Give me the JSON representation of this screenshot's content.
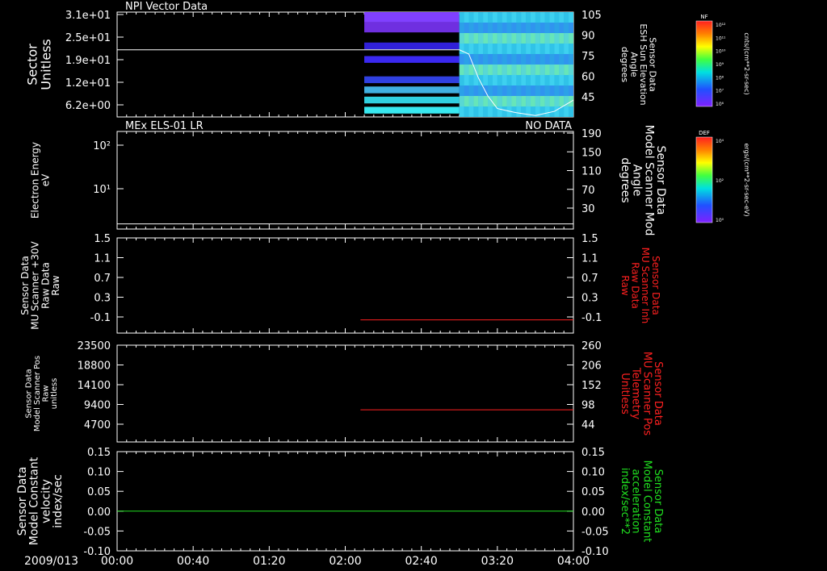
{
  "date_label": "2009/013",
  "time_ticks": [
    "00:00",
    "00:40",
    "01:20",
    "02:00",
    "02:40",
    "03:20",
    "04:00"
  ],
  "colorbars": [
    {
      "tag": "NF",
      "unit": "cnts/(cm**2-sr-sec)",
      "ticks": [
        "10¹²",
        "10¹¹",
        "10¹⁰",
        "10⁹",
        "10⁸",
        "10⁷",
        "10⁶"
      ]
    },
    {
      "tag": "DEF",
      "unit": "ergs/(cm**2-sr-sec-eV)",
      "ticks": [
        "10⁴",
        "10²",
        "10⁰"
      ]
    }
  ],
  "panels": [
    {
      "title_left": "NPI Vector Data",
      "title_right": "",
      "ylabel": [
        "Sector",
        "Unitless"
      ],
      "ylabel_size": 16,
      "ylabel_color": "#ffffff",
      "yticks": [
        "3.1e+01",
        "2.5e+01",
        "1.9e+01",
        "1.2e+01",
        "6.2e+00"
      ],
      "y2label": [
        "Sensor Data",
        "ESH Sun Elevation",
        "Angle",
        "degrees"
      ],
      "y2label_color": "#ffffff",
      "y2label_size": 11,
      "y2ticks": [
        "105",
        "90",
        "75",
        "60",
        "45"
      ]
    },
    {
      "title_left": "MEx ELS-01 LR",
      "title_right": "NO DATA",
      "ylabel": [
        "Electron Energy",
        "eV"
      ],
      "ylabel_size": 12,
      "ylabel_color": "#ffffff",
      "yticks": [
        "10²",
        "10¹"
      ],
      "y2label": [
        "Sensor Data",
        "Model Scanner Mod",
        "Angle",
        "degrees"
      ],
      "y2label_color": "#ffffff",
      "y2label_size": 14,
      "y2ticks": [
        "190",
        "150",
        "110",
        "70",
        "30"
      ]
    },
    {
      "title_left": "",
      "title_right": "",
      "ylabel": [
        "Sensor Data",
        "MU Scanner +30V",
        "Raw Data",
        "Raw"
      ],
      "ylabel_size": 12,
      "ylabel_color": "#ffffff",
      "yticks": [
        "1.5",
        "1.1",
        "0.7",
        "0.3",
        "-0.1"
      ],
      "y2label": [
        "Sensor Data",
        "MU Scanner Inh",
        "Raw Data",
        "Raw"
      ],
      "y2label_color": "#ff2020",
      "y2label_size": 12,
      "y2ticks": [
        "1.5",
        "1.1",
        "0.7",
        "0.3",
        "-0.1"
      ]
    },
    {
      "title_left": "",
      "title_right": "",
      "ylabel": [
        "Sensor Data",
        "Model Scanner Pos",
        "Raw",
        "unitless"
      ],
      "ylabel_size": 10,
      "ylabel_color": "#ffffff",
      "yticks": [
        "23500",
        "18800",
        "14100",
        "9400",
        "4700"
      ],
      "y2label": [
        "Sensor Data",
        "MU Scanner Pos",
        "Telemetry",
        "Unitless"
      ],
      "y2label_color": "#ff2020",
      "y2label_size": 13,
      "y2ticks": [
        "260",
        "206",
        "152",
        "98",
        "44"
      ]
    },
    {
      "title_left": "",
      "title_right": "",
      "ylabel": [
        "Sensor Data",
        "Model Constant",
        "velocity",
        "index/sec"
      ],
      "ylabel_size": 14,
      "ylabel_color": "#ffffff",
      "yticks": [
        "0.15",
        "0.10",
        "0.05",
        "0.00",
        "-0.05",
        "-0.10"
      ],
      "y2label": [
        "Sensor Data",
        "Model Constant",
        "acceleration",
        "index/sec**2"
      ],
      "y2label_color": "#20e020",
      "y2label_size": 13,
      "y2ticks": [
        "0.15",
        "0.10",
        "0.05",
        "0.00",
        "-0.05",
        "-0.10"
      ]
    }
  ],
  "chart_data": [
    {
      "type": "heatmap",
      "title": "NPI Vector Data",
      "x_range": [
        "00:00",
        "04:00"
      ],
      "data_start": "02:10",
      "ylim": [
        0,
        31
      ],
      "overlay_line": {
        "axis": "right",
        "ylim": [
          30,
          105
        ],
        "x": [
          "00:00",
          "01:00",
          "02:00",
          "02:30",
          "03:00",
          "03:05",
          "03:10",
          "03:15",
          "03:20",
          "03:30",
          "03:40",
          "03:50",
          "04:00"
        ],
        "y": [
          78,
          78,
          78,
          78,
          78,
          75,
          58,
          45,
          36,
          33,
          31,
          34,
          42
        ]
      },
      "bands": [
        {
          "x0": "02:10",
          "x1": "03:00",
          "y0": 28,
          "y1": 31,
          "color": "#8040ff"
        },
        {
          "x0": "02:10",
          "x1": "03:00",
          "y0": 25,
          "y1": 28,
          "color": "#6f2fe0"
        },
        {
          "x0": "02:10",
          "x1": "03:00",
          "y0": 20,
          "y1": 22,
          "color": "#3020d8"
        },
        {
          "x0": "02:10",
          "x1": "03:00",
          "y0": 16,
          "y1": 18,
          "color": "#3a28f0"
        },
        {
          "x0": "02:10",
          "x1": "03:00",
          "y0": 10,
          "y1": 12,
          "color": "#3040e0"
        },
        {
          "x0": "02:10",
          "x1": "03:00",
          "y0": 7,
          "y1": 9,
          "color": "#40b0e0"
        },
        {
          "x0": "02:10",
          "x1": "03:00",
          "y0": 4,
          "y1": 6,
          "color": "#30d0e0"
        },
        {
          "x0": "02:10",
          "x1": "03:00",
          "y0": 1,
          "y1": 3,
          "color": "#38e8f0"
        },
        {
          "x0": "03:00",
          "x1": "04:00",
          "y0": 0,
          "y1": 31,
          "color": "#30a8e8"
        }
      ]
    },
    {
      "type": "line",
      "title": "MEx ELS-01 LR",
      "note_right": "NO DATA",
      "y2lim": [
        0,
        190
      ],
      "x": [
        "00:00",
        "04:00"
      ],
      "y2": [
        10,
        10
      ],
      "series_color": "#ffffff"
    },
    {
      "type": "line",
      "ylim": [
        -0.3,
        1.5
      ],
      "x": [
        "02:08",
        "04:00"
      ],
      "y": [
        -0.05,
        -0.05
      ],
      "series_color": "#ff2020"
    },
    {
      "type": "line",
      "ylim": [
        0,
        23500
      ],
      "y2lim": [
        0,
        260
      ],
      "x": [
        "02:08",
        "04:00"
      ],
      "y": [
        7800,
        7800
      ],
      "series_color": "#ff2020"
    },
    {
      "type": "line",
      "ylim": [
        -0.1,
        0.15
      ],
      "x": [
        "00:00",
        "04:00"
      ],
      "y": [
        0.0,
        0.0
      ],
      "series_color": "#20e020"
    }
  ]
}
